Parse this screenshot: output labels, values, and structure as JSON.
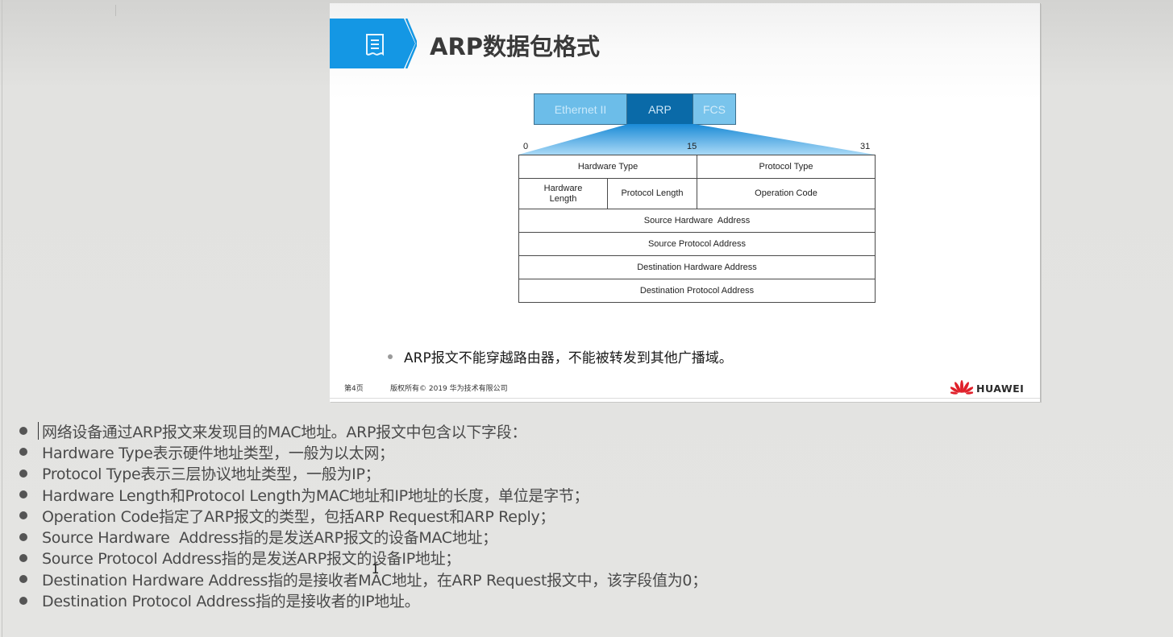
{
  "slide": {
    "title": "ARP数据包格式",
    "title_icon": "document-icon",
    "frame": {
      "segments": [
        {
          "label": "Ethernet II",
          "color": "#6cbde9"
        },
        {
          "label": "ARP",
          "color": "#0a6aa8"
        },
        {
          "label": "FCS",
          "color": "#79c4ec"
        }
      ]
    },
    "bit_markers": [
      "0",
      "15",
      "31"
    ],
    "header_fields": {
      "hardware_type": "Hardware Type",
      "protocol_type": "Protocol Type",
      "hardware_length": "Hardware Length",
      "protocol_length": "Protocol Length",
      "operation_code": "Operation Code",
      "source_hardware_address": "Source Hardware  Address",
      "source_protocol_address": "Source Protocol Address",
      "destination_hardware_address": "Destination Hardware Address",
      "destination_protocol_address": "Destination Protocol Address"
    },
    "bullet": "ARP报文不能穿越路由器，不能被转发到其他广播域。",
    "footer": {
      "page": "第4页",
      "copyright": "版权所有© 2019 华为技术有限公司",
      "brand": "HUAWEI"
    },
    "accent_color": "#1497e4"
  },
  "notes": [
    "网络设备通过ARP报文来发现目的MAC地址。ARP报文中包含以下字段：",
    "Hardware Type表示硬件地址类型，一般为以太网；",
    "Protocol Type表示三层协议地址类型，一般为IP；",
    "Hardware Length和Protocol Length为MAC地址和IP地址的长度，单位是字节；",
    "Operation Code指定了ARP报文的类型，包括ARP Request和ARP Reply；",
    "Source Hardware  Address指的是发送ARP报文的设备MAC地址；",
    "Source Protocol Address指的是发送ARP报文的设备IP地址；",
    "Destination Hardware Address指的是接收者MAC地址，在ARP Request报文中，该字段值为0；",
    "Destination Protocol Address指的是接收者的IP地址。"
  ]
}
